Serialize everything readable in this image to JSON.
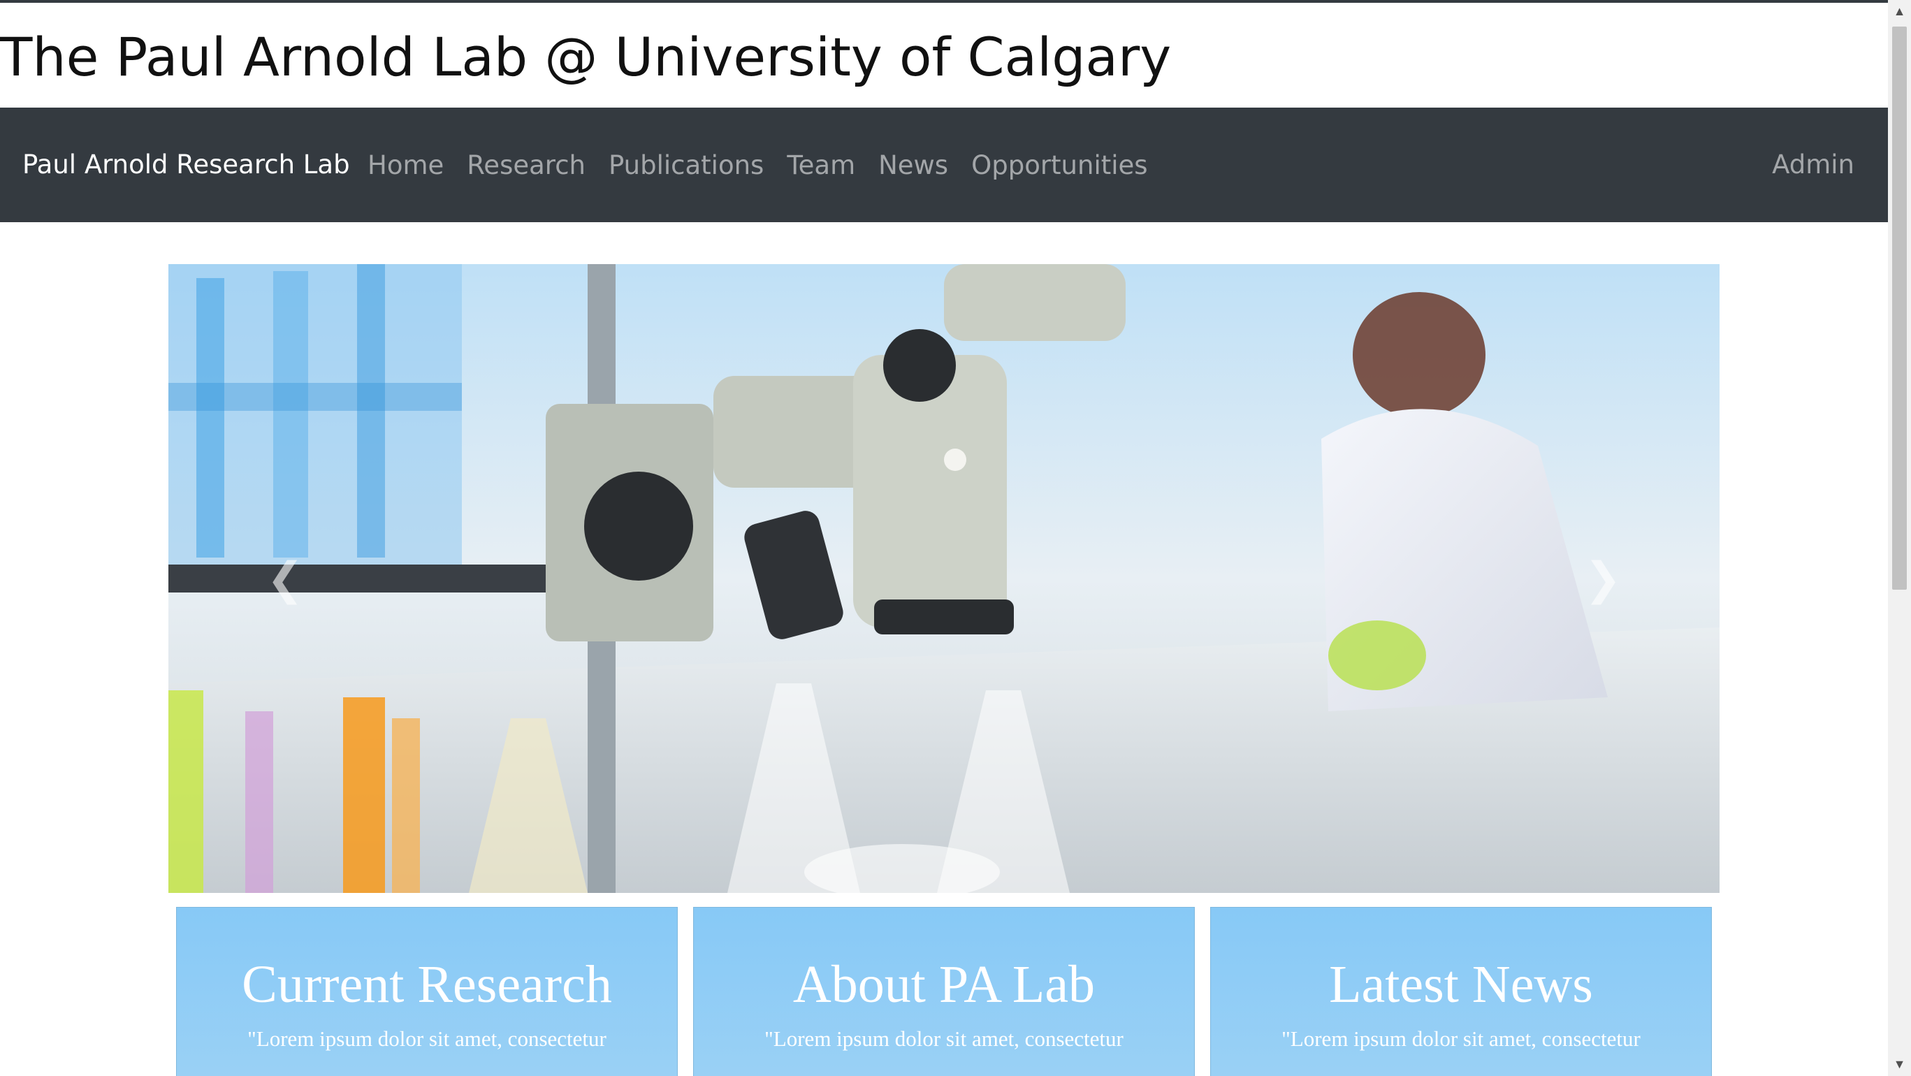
{
  "site": {
    "title": "The Paul Arnold Lab @ University of Calgary"
  },
  "navbar": {
    "brand": "Paul Arnold Research Lab",
    "links": [
      "Home",
      "Research",
      "Publications",
      "Team",
      "News",
      "Opportunities"
    ],
    "admin": "Admin"
  },
  "carousel": {
    "image": "laboratory-microscope-photo",
    "prev_icon": "chevron-left-icon",
    "next_icon": "chevron-right-icon"
  },
  "cards": [
    {
      "title": "Current Research",
      "text": "\"Lorem ipsum dolor sit amet, consectetur"
    },
    {
      "title": "About PA Lab",
      "text": "\"Lorem ipsum dolor sit amet, consectetur"
    },
    {
      "title": "Latest News",
      "text": "\"Lorem ipsum dolor sit amet, consectetur"
    }
  ],
  "colors": {
    "navbar_bg": "#343a40",
    "card_bg": "#87c9f6"
  }
}
